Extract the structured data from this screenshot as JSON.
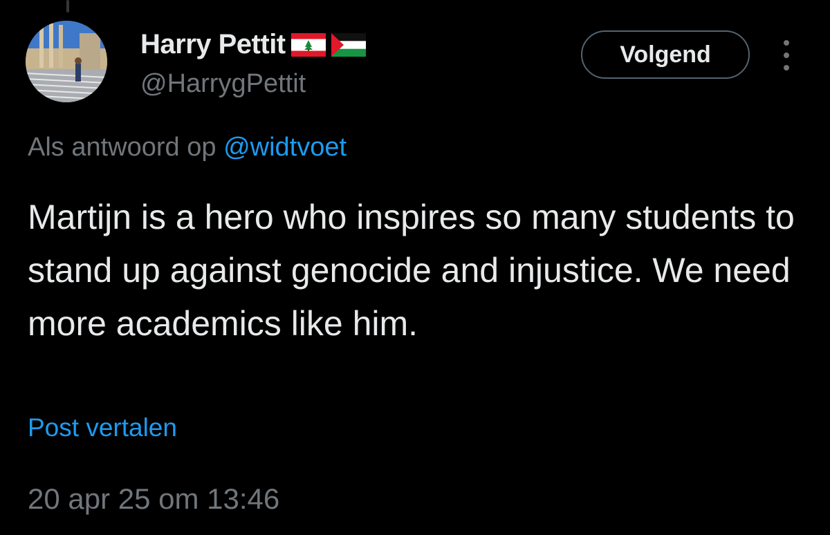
{
  "author": {
    "display_name": "Harry Pettit",
    "flags": [
      "lebanon-flag-icon",
      "palestine-flag-icon"
    ],
    "handle": "@HarrygPettit"
  },
  "follow_button": {
    "label": "Volgend"
  },
  "reply_context": {
    "prefix": "Als antwoord op",
    "mention": "@widtvoet"
  },
  "tweet": {
    "text": "Martijn is a hero who inspires so many students to stand up against genocide and injustice. We need more academics like him."
  },
  "translate_link": {
    "label": "Post vertalen"
  },
  "timestamp": "20 apr 25 om 13:46",
  "colors": {
    "background": "#000000",
    "primary_text": "#e7e9ea",
    "secondary_text": "#71767b",
    "accent": "#1d9bf0",
    "button_border": "#536471"
  }
}
